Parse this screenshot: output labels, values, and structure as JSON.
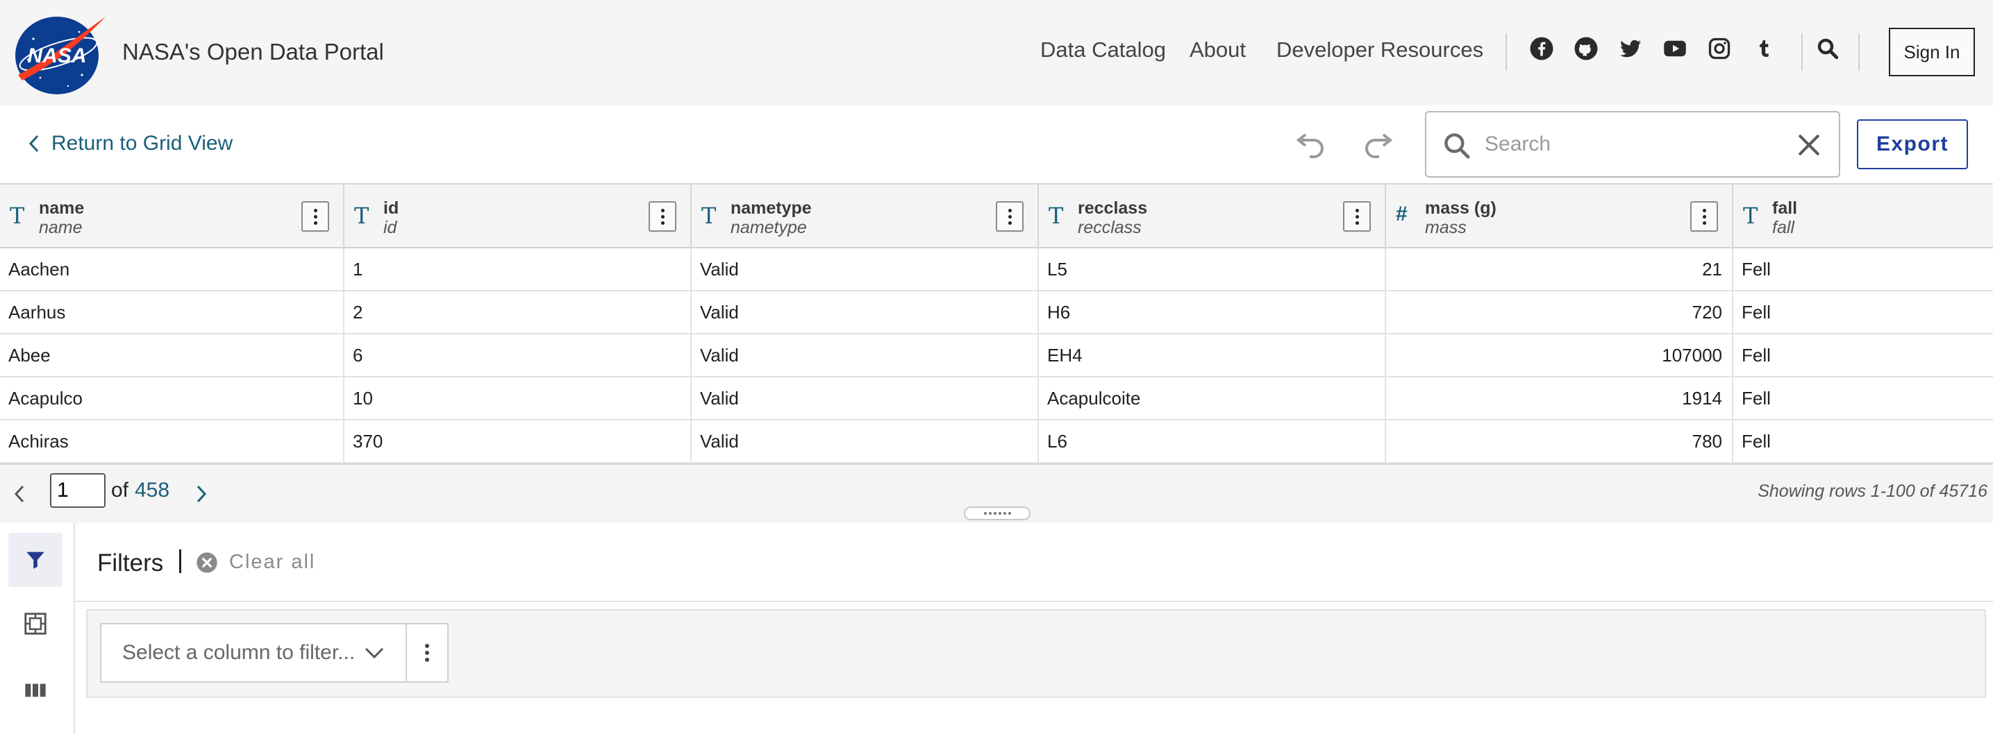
{
  "header": {
    "portal_title": "NASA's Open Data Portal",
    "logo_text": "NASA",
    "nav": [
      {
        "label": "Data Catalog"
      },
      {
        "label": "About"
      },
      {
        "label": "Developer Resources"
      }
    ],
    "social_icons": [
      "facebook-icon",
      "github-icon",
      "twitter-icon",
      "youtube-icon",
      "instagram-icon",
      "tumblr-icon"
    ],
    "sign_in": "Sign In"
  },
  "toolbar": {
    "back_label": "Return to Grid View",
    "search_placeholder": "Search",
    "search_value": "",
    "export_label": "Export"
  },
  "grid": {
    "columns": [
      {
        "type": "T",
        "name": "name",
        "field": "name"
      },
      {
        "type": "T",
        "name": "id",
        "field": "id"
      },
      {
        "type": "T",
        "name": "nametype",
        "field": "nametype"
      },
      {
        "type": "T",
        "name": "recclass",
        "field": "recclass"
      },
      {
        "type": "#",
        "name": "mass (g)",
        "field": "mass"
      },
      {
        "type": "T",
        "name": "fall",
        "field": "fall"
      }
    ],
    "rows": [
      [
        "Aachen",
        "1",
        "Valid",
        "L5",
        "21",
        "Fell"
      ],
      [
        "Aarhus",
        "2",
        "Valid",
        "H6",
        "720",
        "Fell"
      ],
      [
        "Abee",
        "6",
        "Valid",
        "EH4",
        "107000",
        "Fell"
      ],
      [
        "Acapulco",
        "10",
        "Valid",
        "Acapulcoite",
        "1914",
        "Fell"
      ],
      [
        "Achiras",
        "370",
        "Valid",
        "L6",
        "780",
        "Fell"
      ]
    ]
  },
  "pager": {
    "current_page": "1",
    "of_label": "of",
    "total_pages": "458",
    "status": "Showing rows 1-100 of 45716"
  },
  "filters": {
    "title": "Filters",
    "clear_all": "Clear all",
    "select_placeholder": "Select a column to filter..."
  },
  "colors": {
    "accent_teal": "#1a5f7a",
    "export_blue": "#1f3f9e",
    "nasa_blue": "#0b3d91",
    "nasa_red": "#fc3d21"
  }
}
